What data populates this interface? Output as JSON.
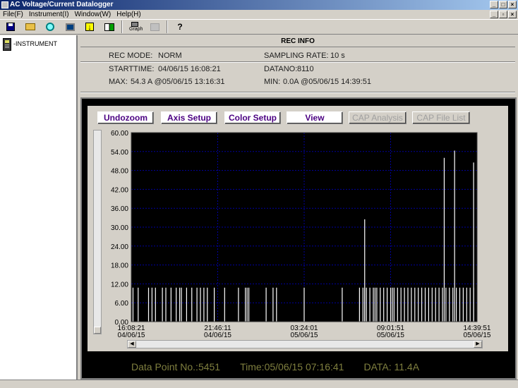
{
  "window": {
    "title": "AC Voltage/Current Datalogger",
    "controls": [
      "_",
      "□",
      "×"
    ],
    "mdi_controls": [
      "_",
      "▫",
      "×"
    ]
  },
  "menubar": [
    "File(F)",
    "Instrument(I)",
    "Window(W)",
    "Help(H)"
  ],
  "toolbar": {
    "graph_label": "Graph",
    "help_label": "?"
  },
  "tree": {
    "items": [
      {
        "label": "-INSTRUMENT",
        "icon": "instrument-icon"
      }
    ]
  },
  "rec_info": {
    "title": "REC INFO",
    "rec_mode_label": "REC MODE:",
    "rec_mode": "NORM",
    "sampling_rate_label": "SAMPLING RATE:",
    "sampling_rate": "10 s",
    "starttime_label": "STARTTIME:",
    "starttime": "04/06/15 16:08:21",
    "datano_label": "DATANO:",
    "datano": "8110",
    "max_label": "MAX:",
    "max": "54.3 A @05/06/15 13:16:31",
    "min_label": "MIN:",
    "min": "0.0A @05/06/15 14:39:51"
  },
  "graph_buttons": [
    {
      "label": "Undozoom",
      "enabled": true
    },
    {
      "label": "Axis Setup",
      "enabled": true
    },
    {
      "label": "Color Setup",
      "enabled": true
    },
    {
      "label": "View",
      "enabled": true
    },
    {
      "label": "CAP Analysis",
      "enabled": false
    },
    {
      "label": "CAP File List",
      "enabled": false
    }
  ],
  "status": {
    "data_point": "Data Point No.:5451",
    "time": "Time:05/06/15 07:16:41",
    "data": "DATA: 11.4A"
  },
  "colors": {
    "plot_bg": "#000000",
    "grid": "#0000a0",
    "trace": "#ffffff",
    "status_text": "#7f7f3f",
    "button_text": "#4b0082"
  },
  "chart_data": {
    "type": "line",
    "ylim": [
      0,
      60
    ],
    "y_ticks": [
      "0.00",
      "6.00",
      "12.00",
      "18.00",
      "24.00",
      "30.00",
      "36.00",
      "42.00",
      "48.00",
      "54.00",
      "60.00"
    ],
    "x_ticks": [
      {
        "time": "16:08:21",
        "date": "04/06/15"
      },
      {
        "time": "21:46:11",
        "date": "04/06/15"
      },
      {
        "time": "03:24:01",
        "date": "05/06/15"
      },
      {
        "time": "09:01:51",
        "date": "05/06/15"
      },
      {
        "time": "14:39:51",
        "date": "05/06/15"
      }
    ],
    "grid": true,
    "baseline_value": 0.0,
    "spike_value": 10.8,
    "spikes_fraction_x": [
      0.005,
      0.02,
      0.05,
      0.06,
      0.07,
      0.09,
      0.1,
      0.115,
      0.13,
      0.14,
      0.145,
      0.16,
      0.175,
      0.19,
      0.2,
      0.21,
      0.22,
      0.24,
      0.27,
      0.31,
      0.33,
      0.335,
      0.34,
      0.39,
      0.41,
      0.42,
      0.5,
      0.61,
      0.66,
      0.67,
      0.675,
      0.68,
      0.69,
      0.7,
      0.705,
      0.71,
      0.72,
      0.73,
      0.74,
      0.75,
      0.755,
      0.76,
      0.77,
      0.78,
      0.79,
      0.8,
      0.81,
      0.82,
      0.83,
      0.84,
      0.85,
      0.86,
      0.87,
      0.88,
      0.89,
      0.9,
      0.91,
      0.92,
      0.93,
      0.94,
      0.95,
      0.96,
      0.97,
      0.98,
      0.99
    ],
    "tall_spikes": [
      {
        "x_fraction": 0.675,
        "value": 32.5
      },
      {
        "x_fraction": 0.905,
        "value": 52.0
      },
      {
        "x_fraction": 0.935,
        "value": 54.3
      },
      {
        "x_fraction": 0.99,
        "value": 50.5
      }
    ]
  }
}
